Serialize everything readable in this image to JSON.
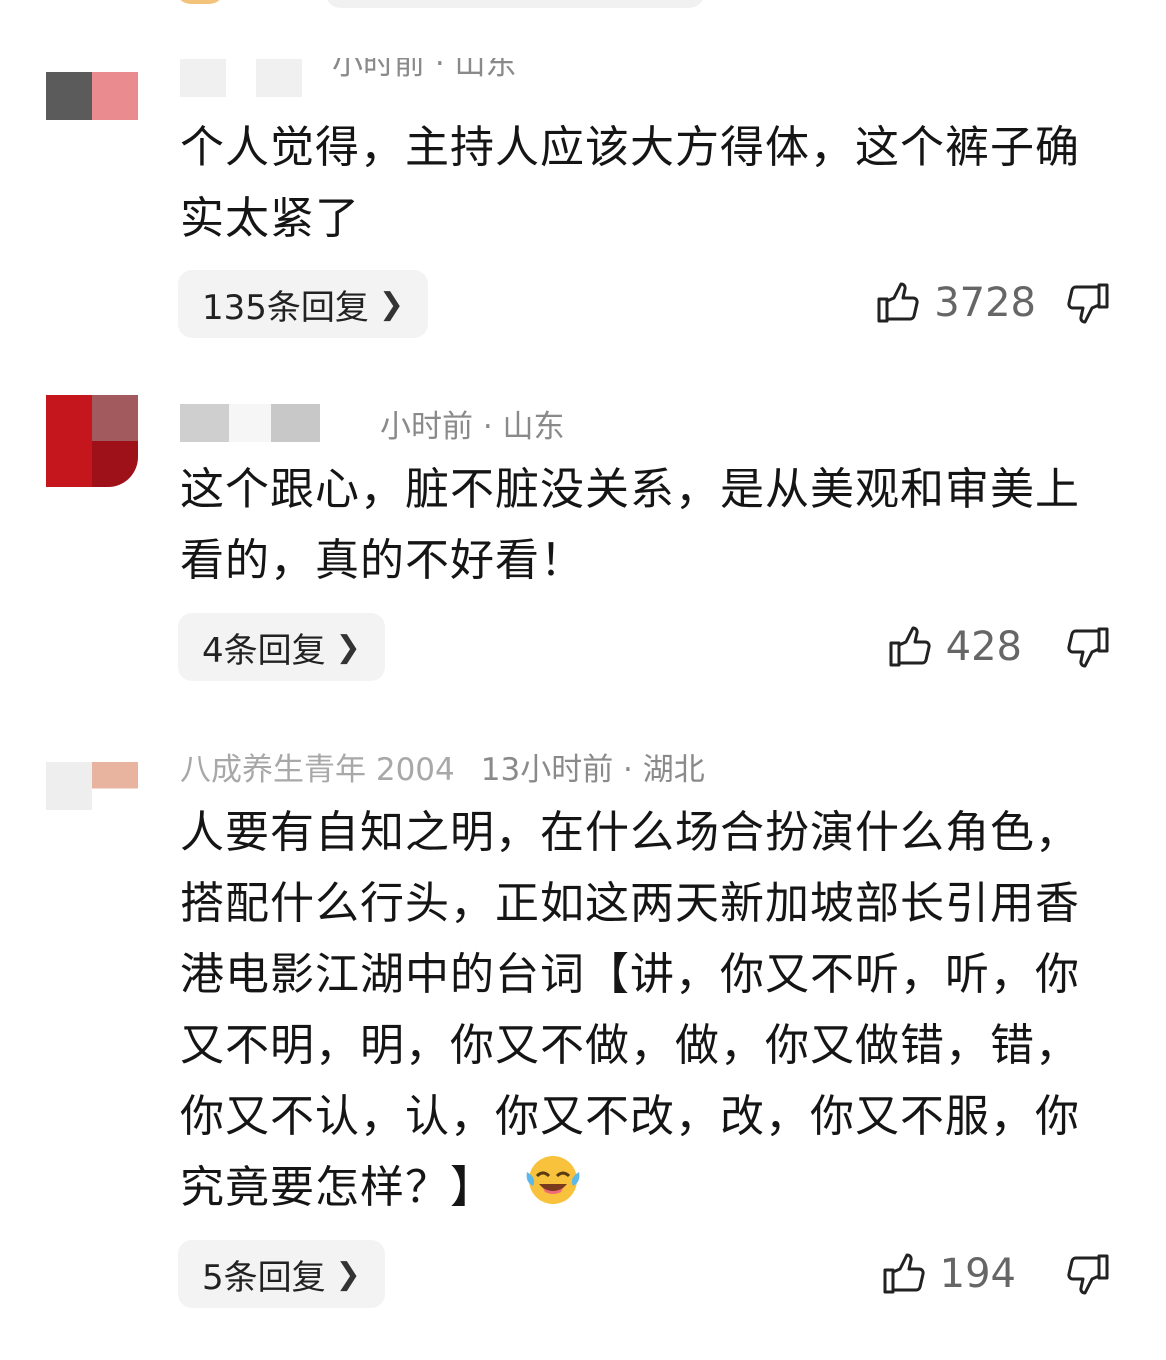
{
  "comments": [
    {
      "username": "",
      "time_location": "小时前 · 山东",
      "text": "个人觉得，主持人应该大方得体，这个裤子确实太紧了",
      "replies": "135条回复",
      "likes": "3728",
      "avatar_colors": [
        "#5b5b5b",
        "#e98b8f"
      ]
    },
    {
      "username": "",
      "time_location": "小时前 · 山东",
      "text": "这个跟心，脏不脏没关系，是从美观和审美上看的，真的不好看！",
      "replies": "4条回复",
      "likes": "428",
      "avatar_colors": [
        "#c4161c",
        "#a3474e"
      ]
    },
    {
      "username": "八成养生青年 2004",
      "time_location": "13小时前 · 湖北",
      "text": "人要有自知之明，在什么场合扮演什么角色，搭配什么行头，正如这两天新加坡部长引用香港电影江湖中的台词【讲，你又不听，听，你又不明，明，你又不做，做，你又做错，错，你又不认，认，你又不改，改，你又不服，你究竟要怎样？】",
      "replies": "5条回复",
      "likes": "194",
      "emoji": "laughing-crying-emoji",
      "avatar_colors": [
        "#eeeeee",
        "#e8b4a0"
      ]
    }
  ]
}
